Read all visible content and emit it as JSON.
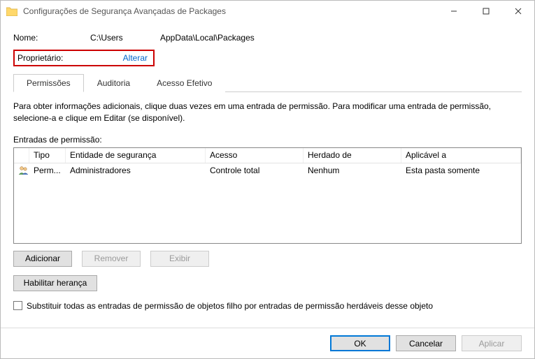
{
  "window": {
    "title": "Configurações de Segurança Avançadas de Packages"
  },
  "fields": {
    "name_label": "Nome:",
    "name_value": "C:\\Users",
    "name_suffix": "AppData\\Local\\Packages",
    "owner_label": "Proprietário:",
    "owner_change": "Alterar"
  },
  "tabs": {
    "permissions": "Permissões",
    "auditing": "Auditoria",
    "effective": "Acesso Efetivo"
  },
  "info_line": "Para obter informações adicionais, clique duas vezes em uma entrada de permissão. Para modificar uma entrada de permissão, selecione-a e clique em Editar (se disponível).",
  "entries_label": "Entradas de permissão:",
  "columns": {
    "type": "Tipo",
    "entity": "Entidade de segurança",
    "access": "Acesso",
    "inherited": "Herdado de",
    "applies": "Aplicável a"
  },
  "rows": [
    {
      "type": "Perm...",
      "entity": "Administradores",
      "access": "Controle total",
      "inherited": "Nenhum",
      "applies": "Esta pasta somente"
    }
  ],
  "buttons": {
    "add": "Adicionar",
    "remove": "Remover",
    "view": "Exibir",
    "enable_inherit": "Habilitar herança",
    "replace_children": "Substituir todas as entradas de permissão de objetos filho por entradas de permissão herdáveis desse objeto",
    "ok": "OK",
    "cancel": "Cancelar",
    "apply": "Aplicar"
  }
}
